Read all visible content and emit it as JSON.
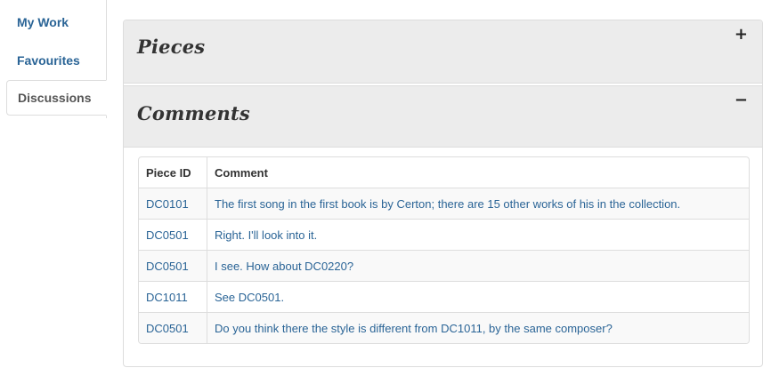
{
  "sidebar": {
    "items": [
      {
        "label": "My Work",
        "active": false
      },
      {
        "label": "Favourites",
        "active": false
      },
      {
        "label": "Discussions",
        "active": true
      }
    ]
  },
  "accordion": {
    "pieces": {
      "title": "Pieces",
      "toggle": "+",
      "expanded": false
    },
    "comments": {
      "title": "Comments",
      "toggle": "−",
      "expanded": true
    }
  },
  "comments_table": {
    "headers": [
      "Piece ID",
      "Comment"
    ],
    "rows": [
      {
        "piece_id": "DC0101",
        "comment": "The first song in the first book is by Certon; there are 15 other works of his in the collection."
      },
      {
        "piece_id": "DC0501",
        "comment": "Right. I'll look into it."
      },
      {
        "piece_id": "DC0501",
        "comment": "I see. How about DC0220?"
      },
      {
        "piece_id": "DC1011",
        "comment": "See DC0501."
      },
      {
        "piece_id": "DC0501",
        "comment": "Do you think there the style is different from DC1011, by the same composer?"
      }
    ]
  },
  "colors": {
    "link": "#2a6496",
    "panel_heading": "#ececec",
    "border": "#dddddd"
  }
}
